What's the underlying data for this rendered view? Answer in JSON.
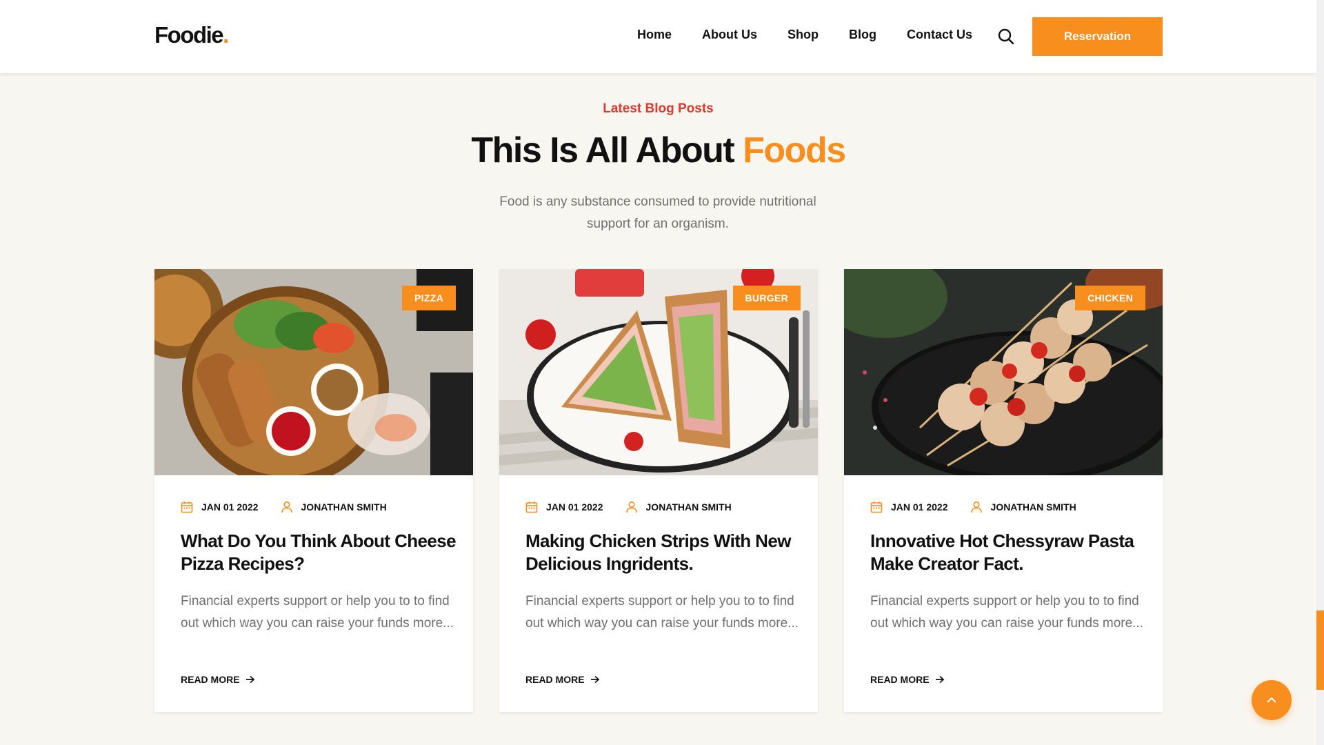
{
  "header": {
    "logo_text": "Foodie",
    "logo_dot": ".",
    "nav": [
      "Home",
      "About Us",
      "Shop",
      "Blog",
      "Contact Us"
    ],
    "reservation_label": "Reservation"
  },
  "section": {
    "eyebrow": "Latest Blog Posts",
    "title_main": "This Is All About ",
    "title_accent": "Foods",
    "description": "Food is any substance consumed to provide nutritional support for an organism."
  },
  "posts": [
    {
      "tag": "PIZZA",
      "date": "JAN 01 2022",
      "author": "JONATHAN SMITH",
      "title": "What Do You Think About Cheese Pizza Recipes?",
      "excerpt": "Financial experts support or help you to to find out which way you can raise your funds more...",
      "read_more": "READ MORE"
    },
    {
      "tag": "BURGER",
      "date": "JAN 01 2022",
      "author": "JONATHAN SMITH",
      "title": "Making Chicken Strips With New Delicious Ingridents.",
      "excerpt": "Financial experts support or help you to to find out which way you can raise your funds more...",
      "read_more": "READ MORE"
    },
    {
      "tag": "CHICKEN",
      "date": "JAN 01 2022",
      "author": "JONATHAN SMITH",
      "title": "Innovative Hot Chessyraw Pasta Make Creator Fact.",
      "excerpt": "Financial experts support or help you to to find out which way you can raise your funds more...",
      "read_more": "READ MORE"
    }
  ],
  "icons": {
    "search": "search-icon",
    "calendar": "calendar-icon",
    "user": "user-icon",
    "arrow": "arrow-right-icon",
    "back_to_top": "chevron-up-icon"
  },
  "colors": {
    "accent": "#f78e1e",
    "eyebrow": "#e1382b",
    "background": "#f8f6f1",
    "text": "#111111",
    "muted": "#6f6f6f"
  }
}
